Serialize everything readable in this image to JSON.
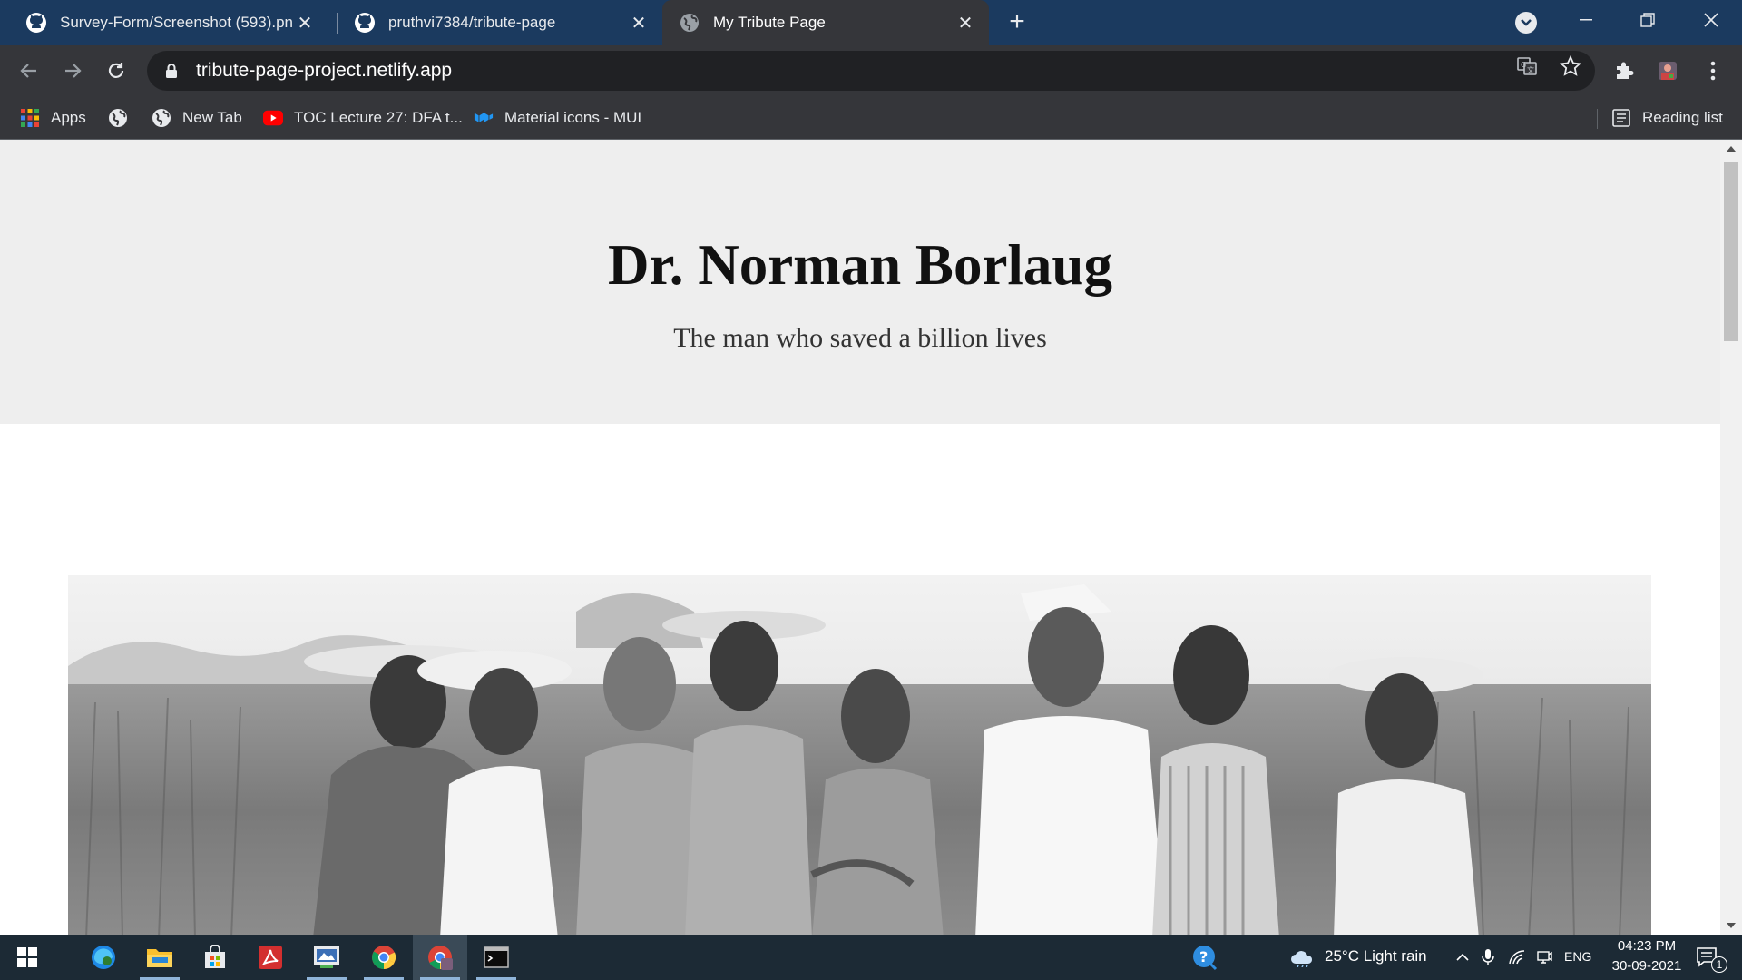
{
  "browser": {
    "tabs": [
      {
        "title": "Survey-Form/Screenshot (593).png",
        "favicon": "github-icon",
        "active": false
      },
      {
        "title": "pruthvi7384/tribute-page",
        "favicon": "github-icon",
        "active": false
      },
      {
        "title": "My Tribute Page",
        "favicon": "globe-icon",
        "active": true
      }
    ],
    "new_tab_label": "+",
    "url": "tribute-page-project.netlify.app"
  },
  "bookmarks": {
    "items": [
      {
        "label": "Apps",
        "icon": "apps-grid-icon"
      },
      {
        "label": "",
        "icon": "globe-icon"
      },
      {
        "label": "New Tab",
        "icon": "globe-icon"
      },
      {
        "label": "TOC Lecture 27: DFA t...",
        "icon": "youtube-icon"
      },
      {
        "label": "Material icons - MUI",
        "icon": "mui-icon"
      }
    ],
    "reading_list": "Reading list"
  },
  "page": {
    "title": "Dr. Norman Borlaug",
    "subtitle": "The man who saved a billion lives"
  },
  "taskbar": {
    "weather": "25°C  Light rain",
    "language": "ENG",
    "time": "04:23 PM",
    "date": "30-09-2021",
    "notification_count": "1"
  },
  "colors": {
    "tabstrip": "#1b3a5f",
    "toolbar": "#35363a",
    "hero_bg": "#eeeeee",
    "taskbar": "#1c2a35"
  }
}
